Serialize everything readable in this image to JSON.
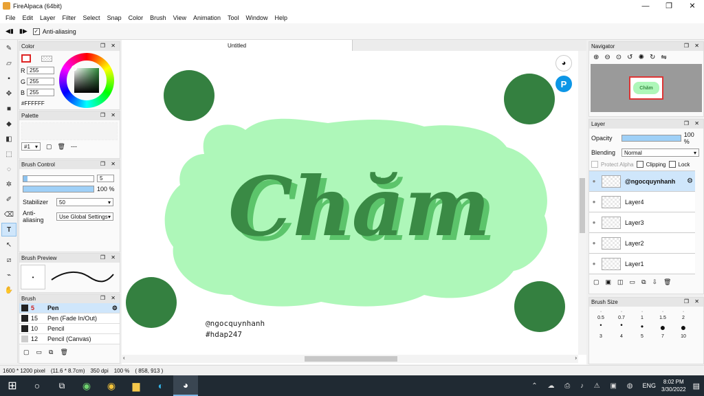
{
  "window": {
    "title": "FireAlpaca (64bit)",
    "minimize": "—",
    "maximize": "❐",
    "close": "✕"
  },
  "menu": [
    "File",
    "Edit",
    "Layer",
    "Filter",
    "Select",
    "Snap",
    "Color",
    "Brush",
    "View",
    "Animation",
    "Tool",
    "Window",
    "Help"
  ],
  "toolbar": {
    "antialias_label": "Anti-aliasing"
  },
  "color_panel": {
    "title": "Color",
    "r_label": "R",
    "g_label": "G",
    "b_label": "B",
    "r": "255",
    "g": "255",
    "b": "255",
    "hex": "#FFFFFF"
  },
  "palette_panel": {
    "title": "Palette",
    "selector": "#1",
    "dashes": "---"
  },
  "brush_control": {
    "title": "Brush Control",
    "size": "5",
    "opacity": "100 %",
    "stabilizer_label": "Stabilizer",
    "stabilizer": "50",
    "antialias_label": "Anti-aliasing",
    "antialias": "Use Global Settings"
  },
  "brush_preview": {
    "title": "Brush Preview"
  },
  "brush_panel": {
    "title": "Brush",
    "items": [
      {
        "size": "5",
        "name": "Pen"
      },
      {
        "size": "15",
        "name": "Pen (Fade In/Out)"
      },
      {
        "size": "10",
        "name": "Pencil"
      },
      {
        "size": "12",
        "name": "Pencil (Canvas)"
      }
    ]
  },
  "canvas": {
    "tab": "Untitled",
    "title_art": "Chăm",
    "credit1": "@ngocquynhanh",
    "credit2": "#hdap247",
    "bg_color": "#aef7b9",
    "dot_color": "#348040",
    "text_color": "#3a8a45"
  },
  "navigator": {
    "title": "Navigator"
  },
  "layer_panel": {
    "title": "Layer",
    "opacity_label": "Opacity",
    "opacity": "100 %",
    "blending_label": "Blending",
    "blending": "Normal",
    "protect_alpha": "Protect Alpha",
    "clipping": "Clipping",
    "lock": "Lock",
    "layers": [
      "@ngocquynhanh",
      "Layer4",
      "Layer3",
      "Layer2",
      "Layer1"
    ]
  },
  "brush_size": {
    "title": "Brush Size",
    "row1": [
      "0.5",
      "0.7",
      "1",
      "1.5",
      "2"
    ],
    "row2": [
      "3",
      "4",
      "5",
      "7",
      "10"
    ]
  },
  "status": {
    "dims": "1600 * 1200 pixel",
    "cm": "(11.6 * 8.7cm)",
    "dpi": "350 dpi",
    "zoom": "100 %",
    "coords": "( 858, 913 )"
  },
  "taskbar": {
    "time": "8:02 PM",
    "date": "3/30/2022",
    "lang": "ENG"
  }
}
